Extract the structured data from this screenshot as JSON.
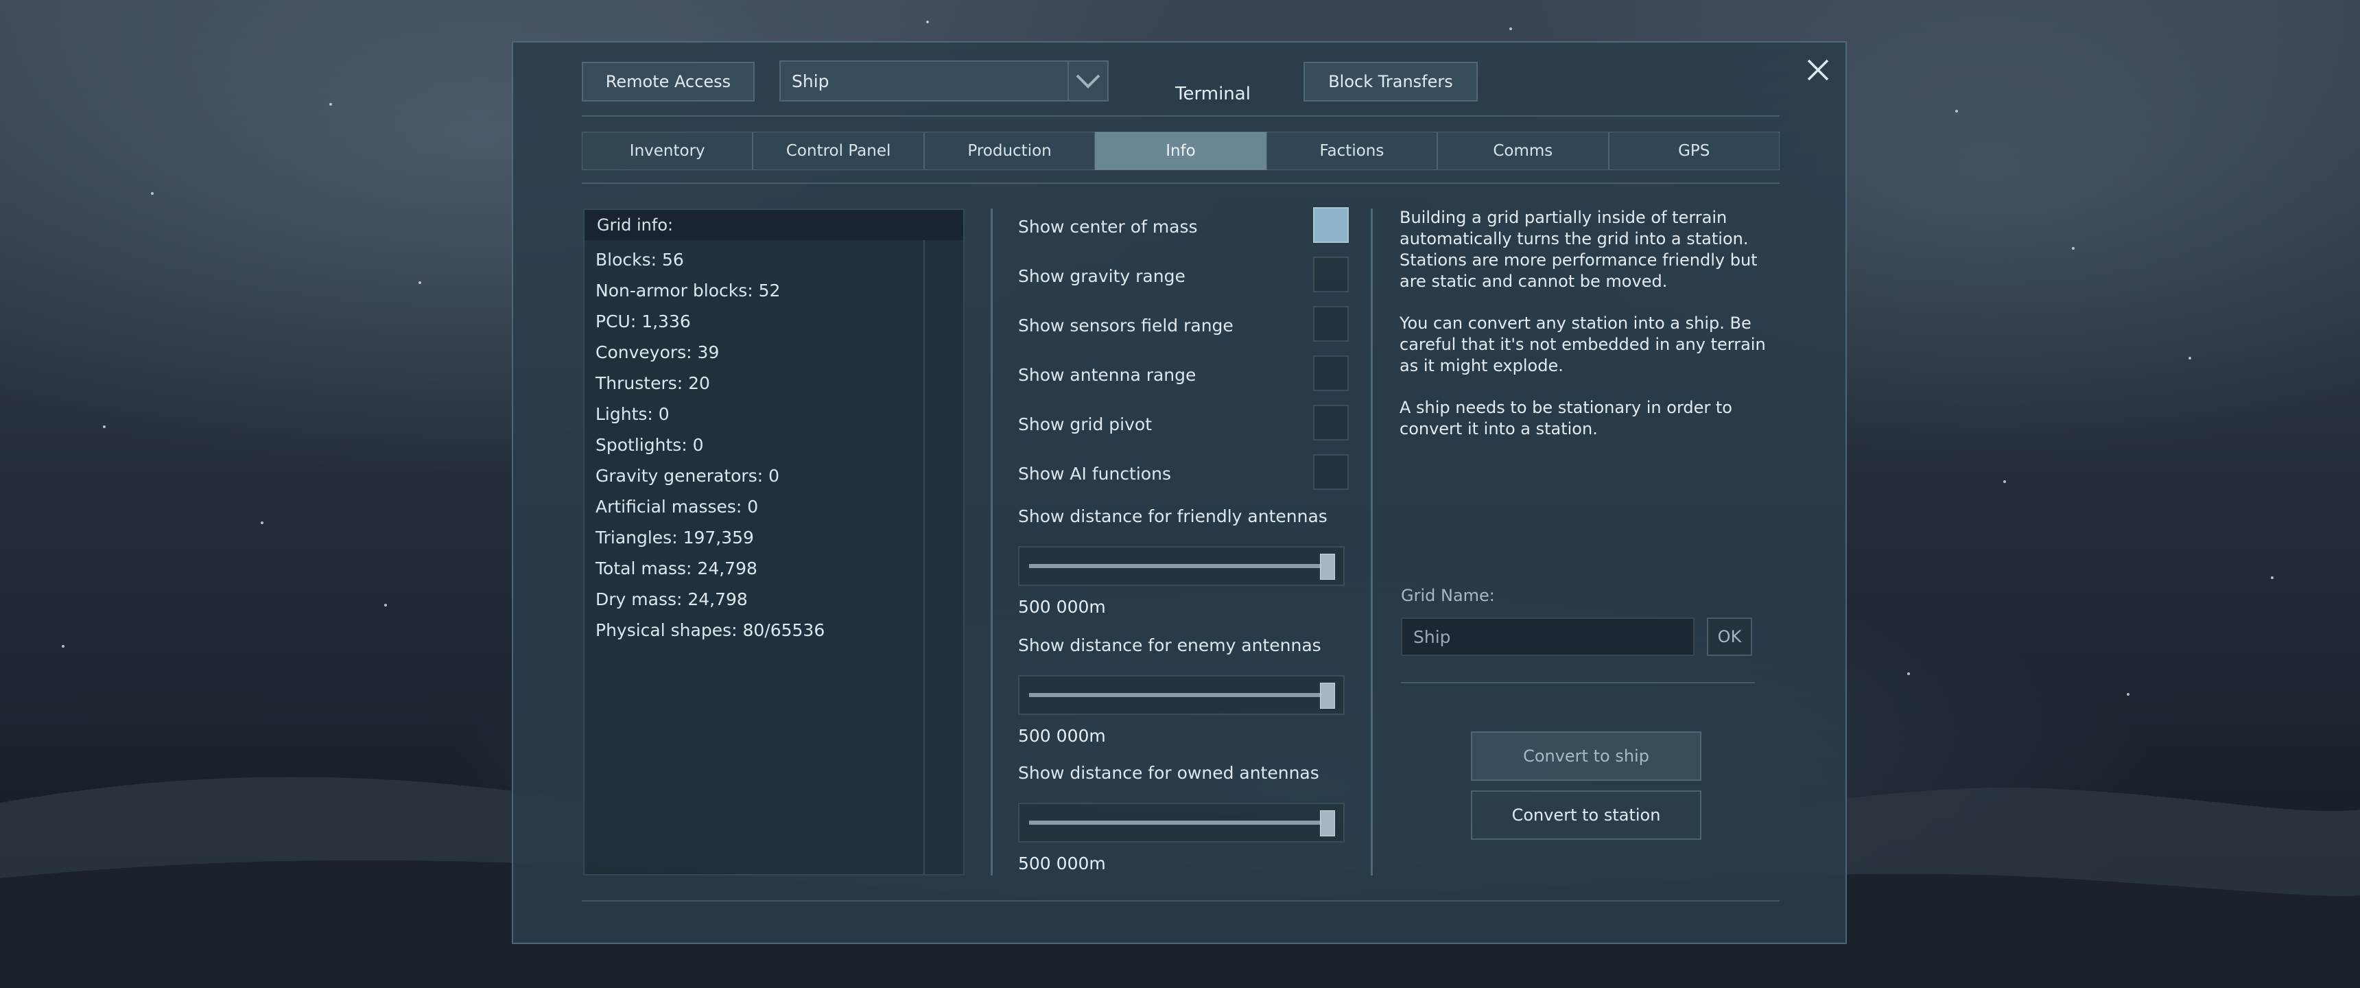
{
  "terminal": {
    "title": "Terminal",
    "remote_access_label": "Remote Access",
    "ship_selector_value": "Ship",
    "block_transfers_label": "Block Transfers"
  },
  "tabs": [
    {
      "label": "Inventory",
      "active": false
    },
    {
      "label": "Control Panel",
      "active": false
    },
    {
      "label": "Production",
      "active": false
    },
    {
      "label": "Info",
      "active": true
    },
    {
      "label": "Factions",
      "active": false
    },
    {
      "label": "Comms",
      "active": false
    },
    {
      "label": "GPS",
      "active": false
    }
  ],
  "grid_info": {
    "header": "Grid info:",
    "lines": [
      "Blocks: 56",
      "Non-armor blocks: 52",
      "PCU: 1,336",
      "Conveyors: 39",
      "Thrusters: 20",
      "Lights: 0",
      "Spotlights: 0",
      "Gravity generators: 0",
      "Artificial masses: 0",
      "Triangles: 197,359",
      "Total mass: 24,798",
      "Dry mass: 24,798",
      "Physical shapes: 80/65536"
    ]
  },
  "options": {
    "center_of_mass": {
      "label": "Show center of mass",
      "checked": true
    },
    "gravity_range": {
      "label": "Show gravity range",
      "checked": false
    },
    "sensors_range": {
      "label": "Show sensors field range",
      "checked": false
    },
    "antenna_range": {
      "label": "Show antenna range",
      "checked": false
    },
    "grid_pivot": {
      "label": "Show grid pivot",
      "checked": false
    },
    "ai_functions": {
      "label": "Show AI functions",
      "checked": false
    }
  },
  "sliders": {
    "friendly": {
      "label": "Show distance for friendly antennas",
      "value_text": "500 000m",
      "fraction": 1.0
    },
    "enemy": {
      "label": "Show distance for enemy antennas",
      "value_text": "500 000m",
      "fraction": 1.0
    },
    "owned": {
      "label": "Show distance for owned antennas",
      "value_text": "500 000m",
      "fraction": 1.0
    }
  },
  "description": {
    "p1": "Building a grid partially inside of terrain automatically turns the grid into a station. Stations are more performance friendly but are static and cannot be moved.",
    "p2": "You can convert any station into a ship. Be careful that it's not embedded in any terrain as it might explode.",
    "p3": "A ship needs to be stationary in order to convert it into a station."
  },
  "grid_name": {
    "label": "Grid Name:",
    "value": "Ship",
    "ok_label": "OK"
  },
  "actions": {
    "convert_to_ship": "Convert to ship",
    "convert_to_station": "Convert to station"
  },
  "icons": {
    "close": "close-icon",
    "dropdown": "chevron-down-icon"
  }
}
